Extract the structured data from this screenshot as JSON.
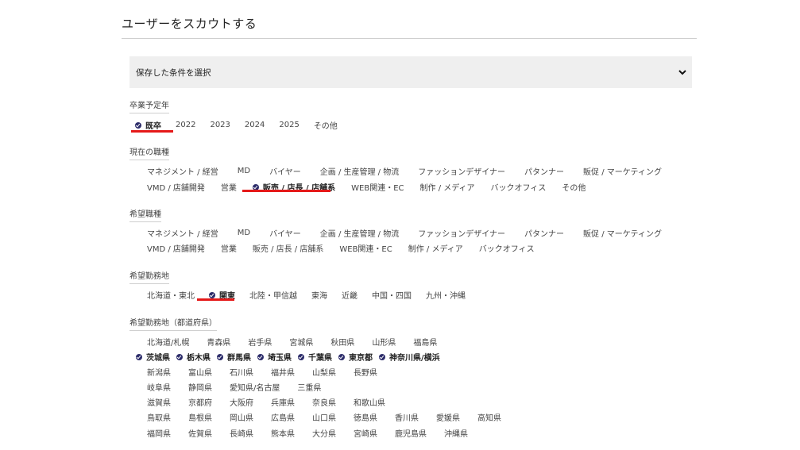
{
  "page": {
    "title": "ユーザーをスカウトする"
  },
  "saved_conditions": {
    "label": "保存した条件を選択"
  },
  "graduation": {
    "label": "卒業予定年",
    "options": [
      {
        "text": "既卒",
        "checked": true
      },
      {
        "text": "2022",
        "checked": false
      },
      {
        "text": "2023",
        "checked": false
      },
      {
        "text": "2024",
        "checked": false
      },
      {
        "text": "2025",
        "checked": false
      },
      {
        "text": "その他",
        "checked": false
      }
    ]
  },
  "current_job": {
    "label": "現在の職種",
    "row1": [
      "マネジメント / 経営",
      "MD",
      "バイヤー",
      "企画 / 生産管理 / 物流",
      "ファッションデザイナー",
      "パタンナー",
      "販促 / マーケティング"
    ],
    "row2": [
      "VMD / 店舗開発",
      "営業",
      "販売 / 店長 / 店舗系",
      "WEB関連・EC",
      "制作 / メディア",
      "バックオフィス",
      "その他"
    ],
    "checked": "販売 / 店長 / 店舗系"
  },
  "desired_job": {
    "label": "希望職種",
    "row1": [
      "マネジメント / 経営",
      "MD",
      "バイヤー",
      "企画 / 生産管理 / 物流",
      "ファッションデザイナー",
      "パタンナー",
      "販促 / マーケティング"
    ],
    "row2": [
      "VMD / 店舗開発",
      "営業",
      "販売 / 店長 / 店舗系",
      "WEB関連・EC",
      "制作 / メディア",
      "バックオフィス"
    ]
  },
  "desired_region": {
    "label": "希望勤務地",
    "options": [
      "北海道・東北",
      "関東",
      "北陸・甲信越",
      "東海",
      "近畿",
      "中国・四国",
      "九州・沖縄"
    ],
    "checked": "関東"
  },
  "desired_prefecture": {
    "label": "希望勤務地（都道府県）",
    "rows": [
      [
        "北海道/札幌",
        "青森県",
        "岩手県",
        "宮城県",
        "秋田県",
        "山形県",
        "福島県"
      ],
      [
        "茨城県",
        "栃木県",
        "群馬県",
        "埼玉県",
        "千葉県",
        "東京都",
        "神奈川県/横浜"
      ],
      [
        "新潟県",
        "富山県",
        "石川県",
        "福井県",
        "山梨県",
        "長野県"
      ],
      [
        "岐阜県",
        "静岡県",
        "愛知県/名古屋",
        "三重県"
      ],
      [
        "滋賀県",
        "京都府",
        "大阪府",
        "兵庫県",
        "奈良県",
        "和歌山県"
      ],
      [
        "鳥取県",
        "島根県",
        "岡山県",
        "広島県",
        "山口県",
        "徳島県",
        "香川県",
        "愛媛県",
        "高知県"
      ],
      [
        "福岡県",
        "佐賀県",
        "長崎県",
        "熊本県",
        "大分県",
        "宮崎県",
        "鹿児島県",
        "沖縄県"
      ]
    ],
    "checked": [
      "茨城県",
      "栃木県",
      "群馬県",
      "埼玉県",
      "千葉県",
      "東京都",
      "神奈川県/横浜"
    ]
  },
  "colors": {
    "check": "#2d2d6b",
    "highlight": "#e51919",
    "select_bg": "#efefef"
  }
}
